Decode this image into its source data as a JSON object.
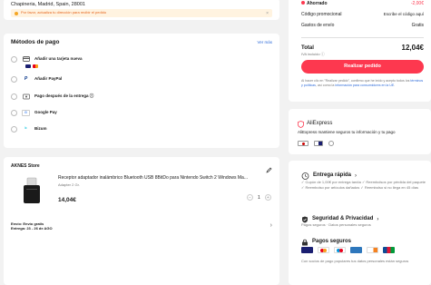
{
  "address": {
    "text": "Chapineria, Madrid, Spain, 28001",
    "warning": "Por favor, actualiza tu dirección para recibir el pedido",
    "close_symbol": "×"
  },
  "payment": {
    "title": "Métodos de pago",
    "see_more": "Ver más",
    "options": [
      {
        "label": "Añadir una tarjeta nueva",
        "icon": "card-icon"
      },
      {
        "label": "Añadir PayPal",
        "icon": "paypal-icon"
      },
      {
        "label": "Pago después de la entrega ⓘ",
        "icon": "pay-later-icon"
      },
      {
        "label": "Google Pay",
        "icon": "google-pay-icon"
      },
      {
        "label": "Bizum",
        "icon": "bizum-icon"
      }
    ]
  },
  "store": {
    "name": "AKNES Store",
    "item": {
      "title": "Receptor adaptador inalámbrico Bluetooth USB 8BitDo para Nintendo Switch 2 Windows Ma...",
      "variant": "Adapter 2 Gr.",
      "price": "14,04€",
      "quantity": "1",
      "minus": "−",
      "plus": "+"
    },
    "shipping_line1": "Envío: Envío gratis",
    "shipping_line2": "Entrega: 23 - 26 de AGO",
    "chevron": "›"
  },
  "summary": {
    "saved_label": "Ahorrado",
    "saved_value": "-2,00€",
    "promo_label": "Código promocional",
    "promo_value": "Escribe el código aquí",
    "shipping_label": "Gastos de envío",
    "shipping_value": "Gratis",
    "total_label": "Total",
    "total_value": "12,04€",
    "tax_note": "IVA incluido ⓘ",
    "button": "Realizar pedido",
    "legal_1": "Al hacer clic en \"Realizar pedido\", confirmo que he leído y acepto todos los ",
    "legal_link_1": "términos y políticas",
    "legal_2": ", así como la ",
    "legal_link_2": "información para consumidores en la UE",
    "legal_3": "."
  },
  "trust": {
    "brand": "AliExpress",
    "text": "AliExpress mantiene seguros tu información y tu pago",
    "badges": [
      "McAfee",
      "Visa",
      "Lock"
    ]
  },
  "delivery": {
    "title": "Entrega rápida",
    "chevron": "›",
    "text": "✓ Cupón de 1,00€ por entrega tardía  ✓ Reembolsos por pérdida del paquete  ✓ Reembolso por artículos dañados  ✓ Reembolso si no llega en 45 días"
  },
  "security": {
    "title": "Seguridad & Privacidad",
    "chevron": "›",
    "text": "Pagos seguros · Datos personales seguros"
  },
  "secure_pay": {
    "title": "Pagos seguros",
    "text": "Con socios de pago populares tus datos personales están seguros",
    "logos": [
      "VISA",
      "Mastercard",
      "Maestro",
      "SafeKey",
      "Discover",
      "JCB"
    ]
  },
  "colors": {
    "accent": "#fd384f",
    "link": "#2e6bd9",
    "warning_bg": "#fff3e0"
  }
}
